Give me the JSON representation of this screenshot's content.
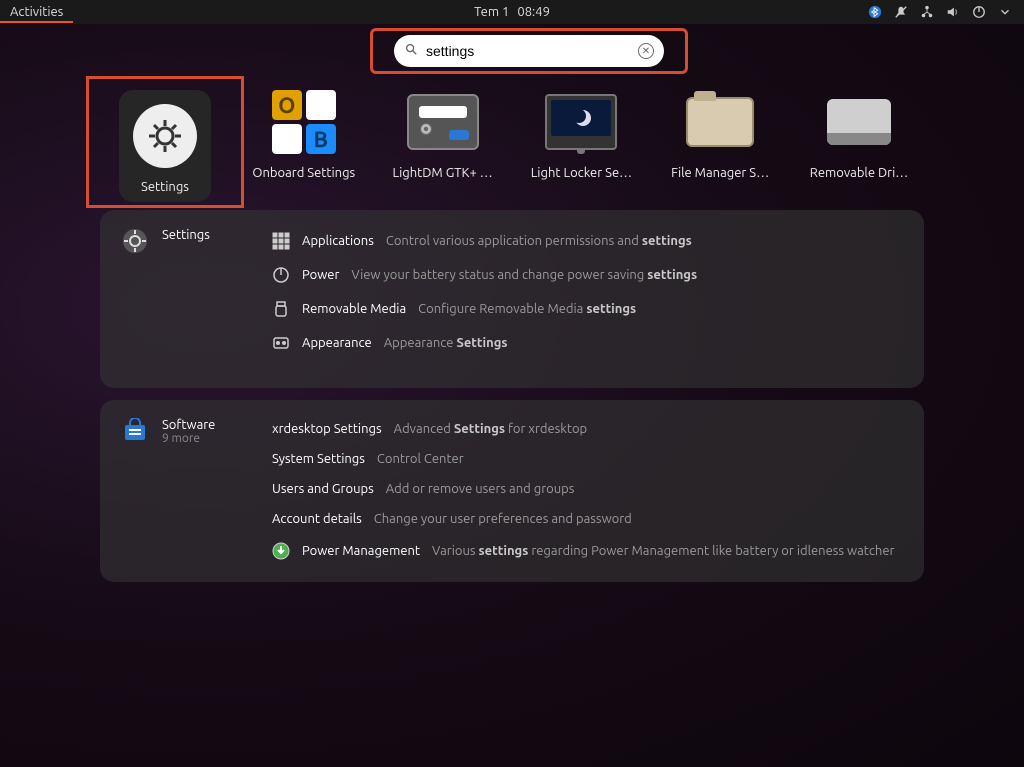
{
  "topbar": {
    "activities_label": "Activities",
    "date": "Tem 1",
    "time": "08:49"
  },
  "search": {
    "value": "settings"
  },
  "apps": [
    {
      "label": "Settings"
    },
    {
      "label": "Onboard Settings"
    },
    {
      "label": "LightDM GTK+ …"
    },
    {
      "label": "Light Locker Se…"
    },
    {
      "label": "File Manager S…"
    },
    {
      "label": "Removable Dri…"
    }
  ],
  "settings_panel": {
    "head_label": "Settings",
    "rows": [
      {
        "name": "Applications",
        "desc_pre": "Control various application permissions and ",
        "desc_bold": "settings",
        "desc_post": ""
      },
      {
        "name": "Power",
        "desc_pre": "View your battery status and change power saving ",
        "desc_bold": "settings",
        "desc_post": ""
      },
      {
        "name": "Removable Media",
        "desc_pre": "Configure Removable Media ",
        "desc_bold": "settings",
        "desc_post": ""
      },
      {
        "name": "Appearance",
        "desc_pre": "Appearance ",
        "desc_bold": "Settings",
        "desc_post": ""
      }
    ]
  },
  "software_panel": {
    "head_label": "Software",
    "head_sub": "9 more",
    "rows": [
      {
        "name": "xrdesktop Settings",
        "desc_pre": "Advanced ",
        "desc_bold": "Settings",
        "desc_post": " for xrdesktop"
      },
      {
        "name": "System Settings",
        "desc_pre": "Control Center",
        "desc_bold": "",
        "desc_post": ""
      },
      {
        "name": "Users and Groups",
        "desc_pre": "Add or remove users and groups",
        "desc_bold": "",
        "desc_post": ""
      },
      {
        "name": "Account details",
        "desc_pre": "Change your user preferences and password",
        "desc_bold": "",
        "desc_post": ""
      },
      {
        "name": "Power Management",
        "desc_pre": "Various ",
        "desc_bold": "settings",
        "desc_post": " regarding Power Management like battery or idleness watcher"
      }
    ]
  }
}
